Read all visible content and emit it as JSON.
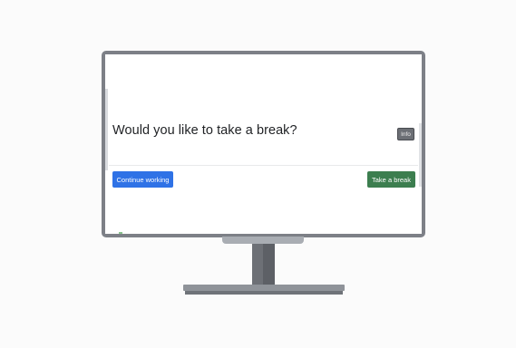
{
  "dialog": {
    "title": "Would you like to take a break?",
    "info_label": "Info",
    "continue_label": "Continue working",
    "break_label": "Take a break"
  },
  "colors": {
    "continue_button": "#2f72e6",
    "break_button": "#3c7e4f",
    "info_button": "#6c6f75",
    "monitor_frame": "#7d8087"
  }
}
